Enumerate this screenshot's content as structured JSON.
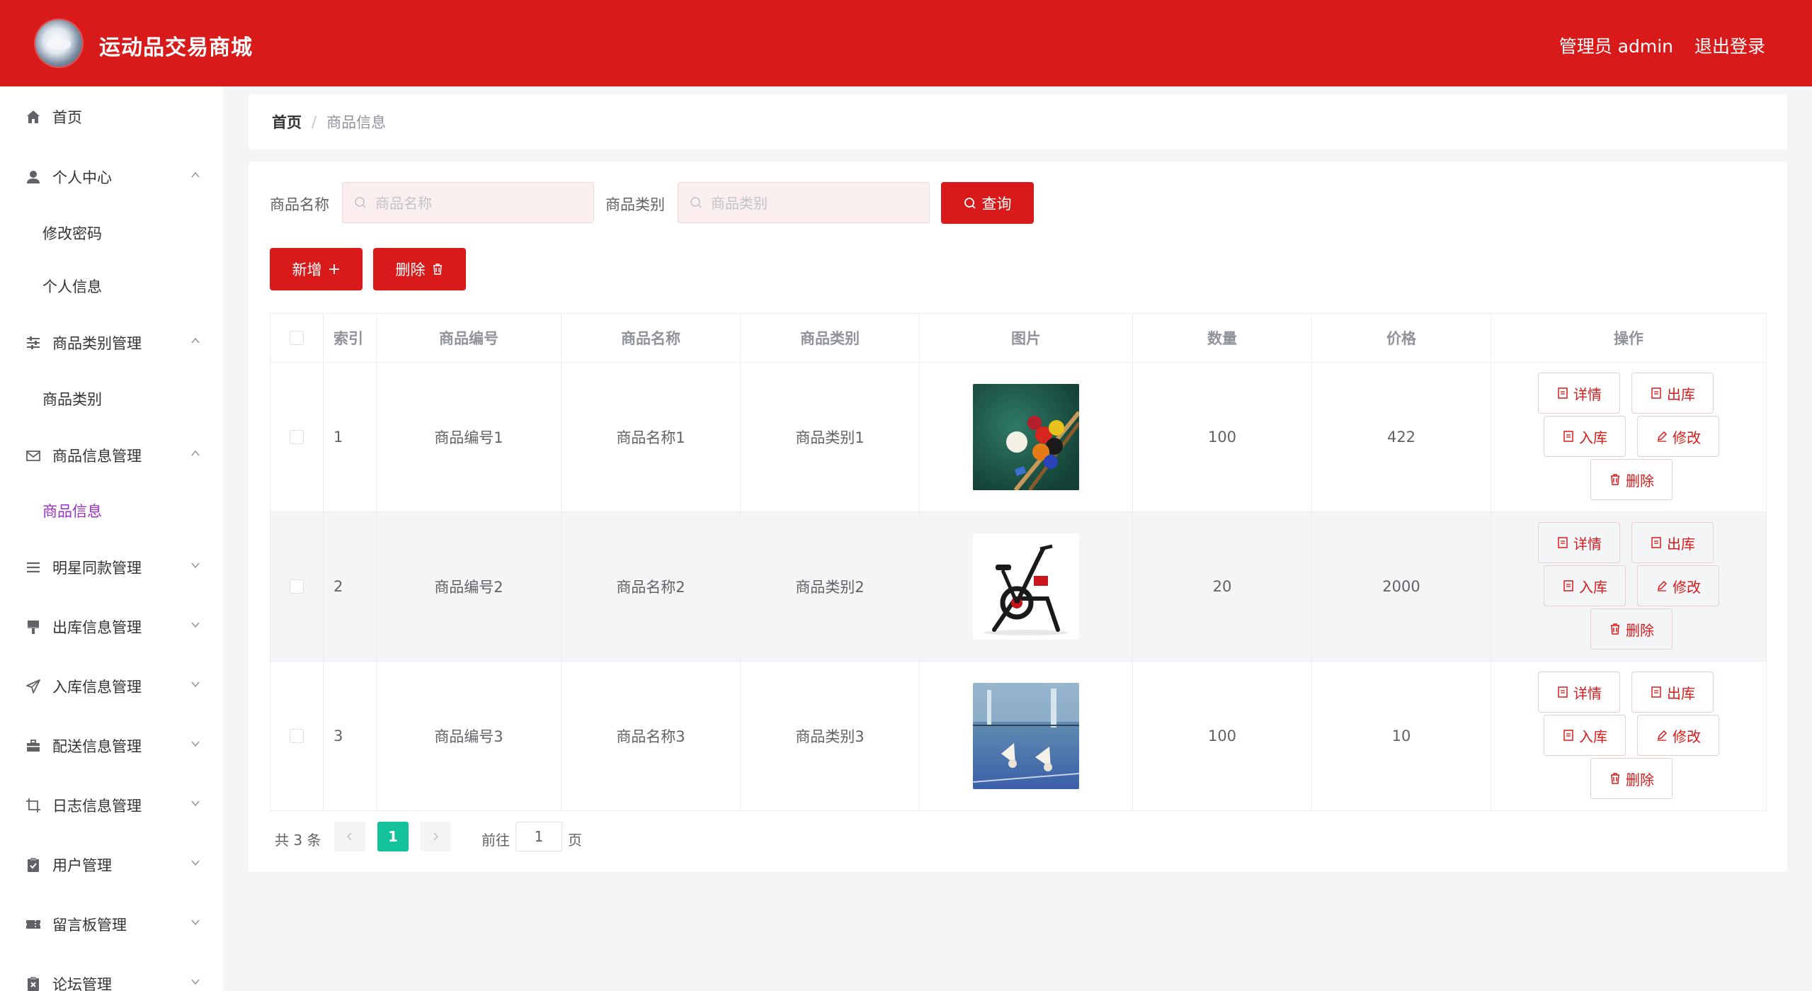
{
  "header": {
    "title": "运动品交易商城",
    "user_label": "管理员 admin",
    "logout_label": "退出登录",
    "background_color": "#d91a1a"
  },
  "sidebar": {
    "items": [
      {
        "label": "首页",
        "icon": "home-icon"
      },
      {
        "label": "个人中心",
        "icon": "user-icon",
        "expanded": true,
        "children": [
          "修改密码",
          "个人信息"
        ]
      },
      {
        "label": "商品类别管理",
        "icon": "sliders-icon",
        "expanded": true,
        "children": [
          "商品类别"
        ]
      },
      {
        "label": "商品信息管理",
        "icon": "mail-icon",
        "expanded": true,
        "children": [
          "商品信息"
        ]
      },
      {
        "label": "明星同款管理",
        "icon": "list-icon",
        "expanded": false
      },
      {
        "label": "出库信息管理",
        "icon": "brush-icon",
        "expanded": false
      },
      {
        "label": "入库信息管理",
        "icon": "send-icon",
        "expanded": false
      },
      {
        "label": "配送信息管理",
        "icon": "briefcase-icon",
        "expanded": false
      },
      {
        "label": "日志信息管理",
        "icon": "crop-icon",
        "expanded": false
      },
      {
        "label": "用户管理",
        "icon": "clipboard-icon",
        "expanded": false
      },
      {
        "label": "留言板管理",
        "icon": "ticket-icon",
        "expanded": false
      },
      {
        "label": "论坛管理",
        "icon": "clipboard-x-icon",
        "expanded": false
      }
    ],
    "active_item": "商品信息",
    "active_color": "#9b2fc9"
  },
  "breadcrumb": {
    "home": "首页",
    "separator": "/",
    "current": "商品信息"
  },
  "search": {
    "name_label": "商品名称",
    "name_placeholder": "商品名称",
    "category_label": "商品类别",
    "category_placeholder": "商品类别",
    "query_button": "查询"
  },
  "toolbar": {
    "add_button": "新增",
    "delete_button": "删除"
  },
  "table": {
    "headers": [
      "索引",
      "商品编号",
      "商品名称",
      "商品类别",
      "图片",
      "数量",
      "价格",
      "操作"
    ],
    "rows": [
      {
        "index": "1",
        "code": "商品编号1",
        "name": "商品名称1",
        "category": "商品类别1",
        "image": "billiards-photo",
        "quantity": "100",
        "price": "422"
      },
      {
        "index": "2",
        "code": "商品编号2",
        "name": "商品名称2",
        "category": "商品类别2",
        "image": "exercise-bike-photo",
        "quantity": "20",
        "price": "2000"
      },
      {
        "index": "3",
        "code": "商品编号3",
        "name": "商品名称3",
        "category": "商品类别3",
        "image": "badminton-photo",
        "quantity": "100",
        "price": "10"
      }
    ],
    "actions": {
      "detail": "详情",
      "outbound": "出库",
      "inbound": "入库",
      "edit": "修改",
      "delete": "删除"
    }
  },
  "pagination": {
    "total": "共 3 条",
    "current_page": "1",
    "goto_label": "前往",
    "goto_value": "1",
    "page_suffix": "页",
    "active_color": "#13c29a"
  }
}
